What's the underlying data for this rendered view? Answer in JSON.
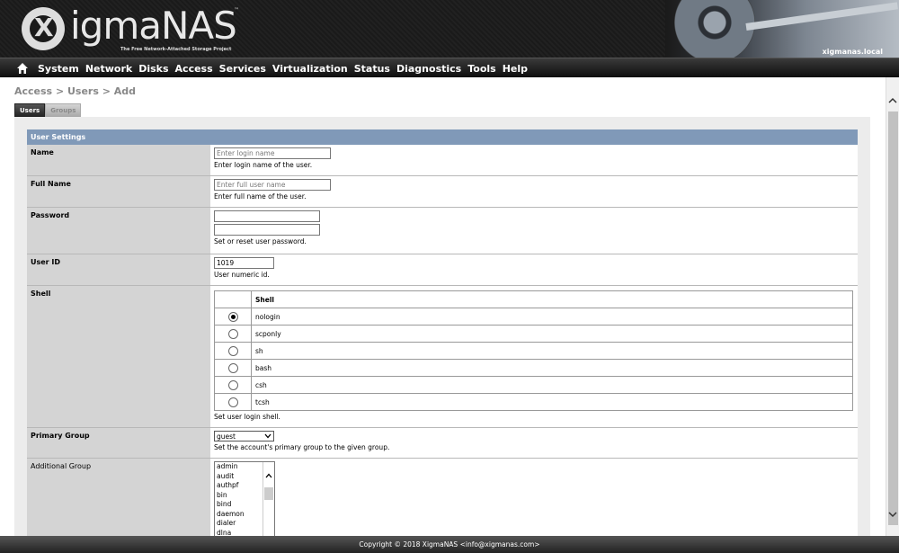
{
  "header": {
    "logo_x": "X",
    "logo_text": "igmaNAS",
    "logo_tm": "™",
    "tagline": "The Free Network-Attached Storage Project",
    "hostname": "xigmanas.local"
  },
  "nav": {
    "items": [
      "System",
      "Network",
      "Disks",
      "Access",
      "Services",
      "Virtualization",
      "Status",
      "Diagnostics",
      "Tools",
      "Help"
    ]
  },
  "breadcrumb": "Access > Users > Add",
  "tabs": {
    "users": "Users",
    "groups": "Groups"
  },
  "section": {
    "title": "User Settings"
  },
  "form": {
    "name": {
      "label": "Name",
      "placeholder": "Enter login name",
      "desc": "Enter login name of the user."
    },
    "fullname": {
      "label": "Full Name",
      "placeholder": "Enter full user name",
      "desc": "Enter full name of the user."
    },
    "password": {
      "label": "Password",
      "desc": "Set or reset user password."
    },
    "userid": {
      "label": "User ID",
      "value": "1019",
      "desc": "User numeric id."
    },
    "shell": {
      "label": "Shell",
      "column": "Shell",
      "options": [
        "nologin",
        "scponly",
        "sh",
        "bash",
        "csh",
        "tcsh"
      ],
      "selected": "nologin",
      "desc": "Set user login shell."
    },
    "primary_group": {
      "label": "Primary Group",
      "value": "guest",
      "desc": "Set the account's primary group to the given group."
    },
    "additional_group": {
      "label": "Additional Group",
      "options": [
        "admin",
        "audit",
        "authpf",
        "bin",
        "bind",
        "daemon",
        "dialer",
        "dlna"
      ]
    }
  },
  "footer": {
    "text": "Copyright © 2018 XigmaNAS <info@xigmanas.com>"
  }
}
